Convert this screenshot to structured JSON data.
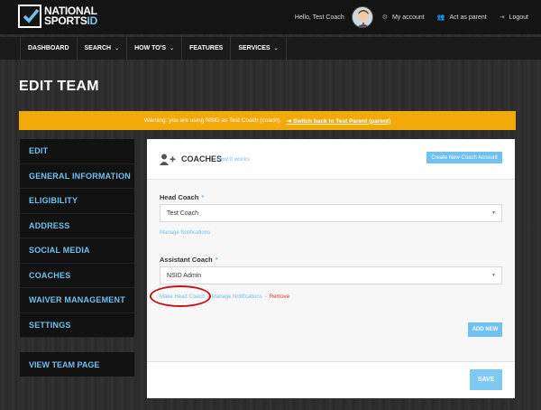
{
  "header": {
    "logo_line1": "NATIONAL",
    "logo_line2": "SPORTS",
    "logo_num": "ID",
    "greeting": "Hello, Test Coach",
    "my_account": "My account",
    "act_as_parent": "Act as parent",
    "logout": "Logout"
  },
  "nav": {
    "items": [
      {
        "label": "DASHBOARD",
        "dropdown": false
      },
      {
        "label": "SEARCH",
        "dropdown": true
      },
      {
        "label": "HOW TO'S",
        "dropdown": true
      },
      {
        "label": "FEATURES",
        "dropdown": false
      },
      {
        "label": "SERVICES",
        "dropdown": true
      }
    ]
  },
  "page": {
    "title": "EDIT TEAM"
  },
  "warning": {
    "text": "Warning: you are using NSID as Test Coach (coach).",
    "switch_label": "Switch back to Test Parent (parent)"
  },
  "sidebar": {
    "items": [
      {
        "label": "EDIT"
      },
      {
        "label": "GENERAL INFORMATION"
      },
      {
        "label": "ELIGIBILITY"
      },
      {
        "label": "ADDRESS"
      },
      {
        "label": "SOCIAL MEDIA"
      },
      {
        "label": "COACHES"
      },
      {
        "label": "WAIVER MANAGEMENT"
      },
      {
        "label": "SETTINGS"
      }
    ],
    "view_team_page": "VIEW TEAM PAGE"
  },
  "coaches": {
    "title": "COACHES",
    "how_it_works": "How it works",
    "create_button": "Create New Coach Account",
    "head_coach_label": "Head Coach",
    "required_mark": "*",
    "head_coach_value": "Test Coach",
    "manage_notifications": "Manage Notifications",
    "assistant_coach_label": "Assistant Coach",
    "assistant_coach_value": "NSID Admin",
    "make_head_coach": "Make Head Coach",
    "separator": "-",
    "remove": "Remove",
    "add_new": "ADD NEW",
    "save": "SAVE"
  },
  "colors": {
    "accent": "#6ec1f0",
    "warning": "#f4a90a",
    "highlight_circle": "#c0161b"
  }
}
